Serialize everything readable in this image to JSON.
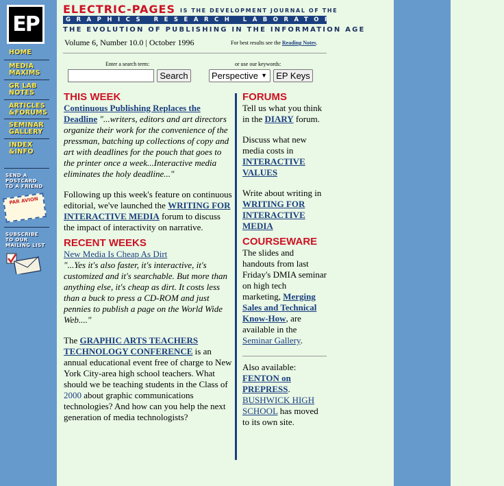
{
  "sidebar": {
    "logo": "EP",
    "nav": [
      {
        "line1": "HOME",
        "line2": ""
      },
      {
        "line1": "MEDIA",
        "line2": "MAXIMS"
      },
      {
        "line1": "GR LAB",
        "line2": "NOTES"
      },
      {
        "line1": "ARTICLES",
        "line2": "&FORUMS"
      },
      {
        "line1": "SEMINAR",
        "line2": "GALLERY"
      },
      {
        "line1": "INDEX",
        "line2": "&INFO"
      }
    ],
    "postcard": [
      "SEND A",
      "POSTCARD",
      "TO A FRIEND"
    ],
    "par_avion": "PAR AVION",
    "mailing": [
      "SUBSCRIBE",
      "TO OUR",
      "MAILING LIST"
    ]
  },
  "masthead": {
    "title": "ELECTRIC-PAGES",
    "tagline": "IS THE DEVELOPMENT JOURNAL OF THE",
    "bar": "GRAPHICS RESEARCH LABORATORY",
    "subtitle": "THE EVOLUTION OF PUBLISHING IN THE INFORMATION AGE",
    "issue": "Volume 6, Number 10.0 | October 1996",
    "best_prefix": "For best results see the",
    "best_link": "Reading Notes",
    "best_suffix": "."
  },
  "search": {
    "label": "Enter a search term:",
    "value": "",
    "button": "Search",
    "keywords_label": "or use our keywords:",
    "keyword_selected": "Perspective",
    "keys_button": "EP Keys"
  },
  "left": {
    "this_week_head": "THIS WEEK",
    "feature_link": "Continuous Publishing Replaces the Deadline",
    "feature_quote": "\"...writers, editors and art directors organize their work for the convenience of the pressman, batching up collections of copy and art with deadlines for the pouch that goes to the printer once a week...Interactive media eliminates the holy deadline...\"",
    "follow_pre": "Following up this week's feature on continuous editorial, we've launched the",
    "follow_link": "WRITING FOR INTERACTIVE MEDIA",
    "follow_post": "forum to discuss the impact of interactivity on narrative.",
    "recent_head": "RECENT WEEKS",
    "recent_link": "New Media Is Cheap As Dirt",
    "recent_quote": "\"...Yes it's also faster, it's interactive, it's customized and it's searchable. But more than anything else, it's cheap as dirt. It costs less than a buck to press a CD-ROM and just pennies to publish a page on the World Wide Web....\"",
    "conf_pre": "The",
    "conf_link": "GRAPHIC ARTS TEACHERS TECHNOLOGY CONFERENCE",
    "conf_post": "is an annual educational event free of charge to New York City-area high school teachers. What should we be teaching students in the Class of",
    "conf_year": "2000",
    "conf_tail": "about graphic communications technologies? And how can you help the next generation of media technologists?"
  },
  "right": {
    "forums_head": "FORUMS",
    "forum1_pre": "Tell us what you think in the",
    "forum1_link": "DIARY",
    "forum1_post": "forum.",
    "forum2_pre": "Discuss what new media costs in",
    "forum2_link": "INTERACTIVE VALUES",
    "forum3_pre": "Write about writing in",
    "forum3_link": "WRITING FOR INTERACTIVE MEDIA",
    "courseware_head": "COURSEWARE",
    "course_pre": "The slides and handouts from last Friday's DMIA seminar on high tech marketing,",
    "course_link": "Merging Sales and Technical Know-How",
    "course_mid": ", are available in the",
    "course_link2": "Seminar Gallery",
    "course_post": ".",
    "also_pre": "Also available:",
    "also_link1": "FENTON on PREPRESS",
    "also_sep": ".",
    "also_link2": "BUSHWICK HIGH SCHOOL",
    "also_post": "has moved to its own site."
  },
  "colors": {
    "sidebar": "#6699cc",
    "content_bg": "#eaf8e6",
    "link": "#1a3f7f",
    "section_head": "#cc1122",
    "nav_text": "#ffe94a"
  }
}
